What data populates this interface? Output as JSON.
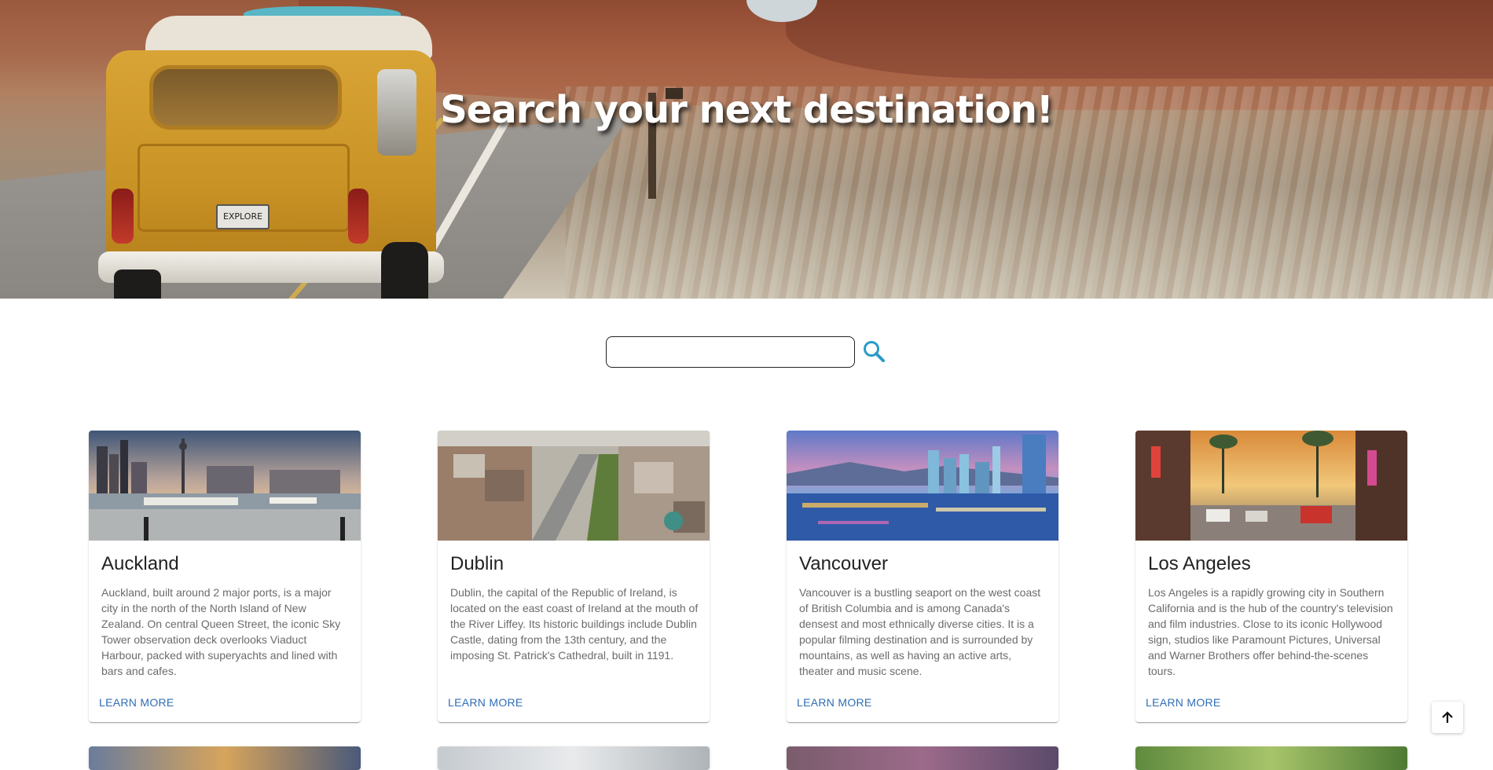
{
  "hero": {
    "title": "Search your next destination!",
    "plate_text": "EXPLORE"
  },
  "search": {
    "value": "",
    "placeholder": "",
    "icon": "search-icon"
  },
  "cards": [
    {
      "title": "Auckland",
      "description": "Auckland, built around 2 major ports, is a major city in the north of the North Island of New Zealand. On central Queen Street, the iconic Sky Tower observation deck overlooks Viaduct Harbour, packed with superyachts and lined with bars and cafes.",
      "link": "LEARN MORE"
    },
    {
      "title": "Dublin",
      "description": "Dublin, the capital of the Republic of Ireland, is located on the east coast of Ireland at the mouth of the River Liffey. Its historic buildings include Dublin Castle, dating from the 13th century, and the imposing St. Patrick's Cathedral, built in 1191.",
      "link": "LEARN MORE"
    },
    {
      "title": "Vancouver",
      "description": "Vancouver is a bustling seaport on the west coast of British Columbia and is among Canada's densest and most ethnically diverse cities. It is a popular filming destination and is surrounded by mountains, as well as having an active arts, theater and music scene.",
      "link": "LEARN MORE"
    },
    {
      "title": "Los Angeles",
      "description": "Los Angeles is a rapidly growing city in Southern California and is the hub of the country's television and film industries. Close to its iconic Hollywood sign, studios like Paramount Pictures, Universal and Warner Brothers offer behind-the-scenes tours.",
      "link": "LEARN MORE"
    }
  ],
  "scroll_top": {
    "icon": "arrow-up-icon"
  },
  "colors": {
    "link": "#2f6db5",
    "search_icon": "#2a9bc8",
    "card_text": "#6b6b6b"
  }
}
